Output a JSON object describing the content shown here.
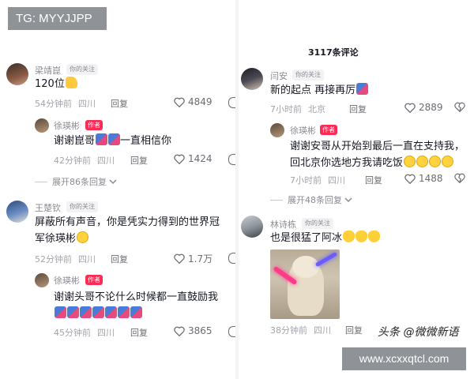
{
  "watermarks": {
    "top_left": "TG: MYYJJPP",
    "bottom_right": "www.xcxxqtcl.com",
    "source": "头条 @微微新语"
  },
  "left": {
    "comments": [
      {
        "user": "梁靖崑",
        "tag": "你的关注",
        "text": "120位",
        "emoji": "thumb-icon",
        "time": "54分钟前",
        "location": "四川",
        "reply_label": "回复",
        "likes": "4849",
        "reply": {
          "user": "徐瑛彬",
          "tag": "作者",
          "text_before": "谢谢崑哥",
          "text_after": "一直相信你",
          "time": "42分钟前",
          "location": "四川",
          "reply_label": "回复",
          "likes": "1424"
        },
        "expand": "展开86条回复"
      },
      {
        "user": "王楚钦",
        "tag": "你的关注",
        "text": "屏蔽所有声音，你是凭实力得到的世界冠军徐瑛彬",
        "line1": "屏蔽所有声音，你是凭实力得到的世界冠",
        "line2": "军徐瑛彬",
        "time": "52分钟前",
        "location": "四川",
        "reply_label": "回复",
        "likes": "1.7万",
        "reply": {
          "user": "徐瑛彬",
          "tag": "作者",
          "text": "谢谢头哥不论什么时候都一直鼓励我",
          "time": "45分钟前",
          "location": "四川",
          "reply_label": "回复",
          "likes": "3865"
        }
      }
    ]
  },
  "right": {
    "comment_count": "3117条评论",
    "comments": [
      {
        "user": "闫安",
        "tag": "你的关注",
        "text": "新的起点 再接再厉",
        "time": "7小时前",
        "location": "北京",
        "reply_label": "回复",
        "likes": "2889",
        "reply": {
          "user": "徐瑛彬",
          "tag": "作者",
          "line1": "谢谢安哥从开始到最后一直在支持我，",
          "line2": "回北京你选地方我请吃饭",
          "time": "7小时前",
          "location": "四川",
          "reply_label": "回复",
          "likes": "1488"
        },
        "expand": "展开48条回复"
      },
      {
        "user": "林诗栋",
        "tag": "你的关注",
        "text": "也是很猛了阿冰",
        "time": "38分钟前",
        "location": "四川",
        "reply_label": "回复"
      }
    ]
  },
  "colors": {
    "author_tag": "#fe2c55",
    "meta": "#a3a4aa",
    "username": "#8a8b91",
    "watermark_bg": "#8f9297"
  }
}
